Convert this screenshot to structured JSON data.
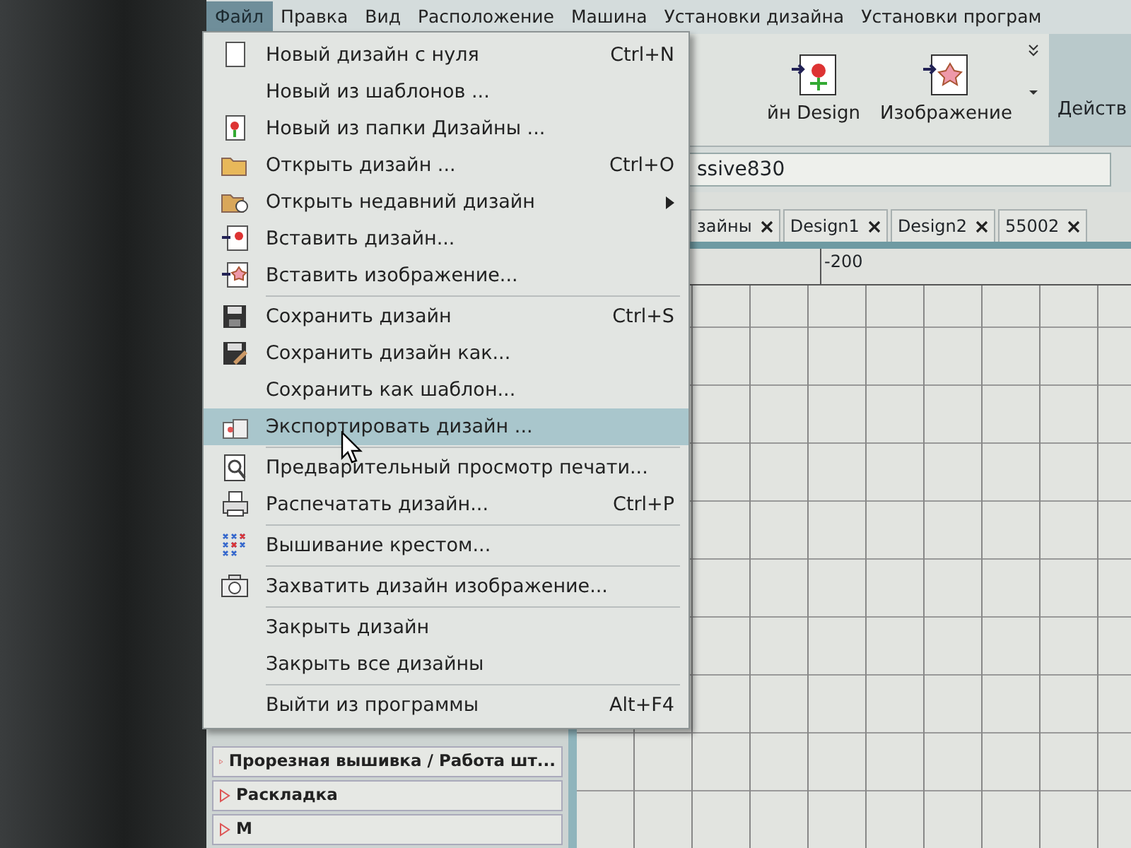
{
  "menu_bar": [
    {
      "label": "Файл",
      "selected": true
    },
    {
      "label": "Правка",
      "selected": false
    },
    {
      "label": "Вид",
      "selected": false
    },
    {
      "label": "Расположение",
      "selected": false
    },
    {
      "label": "Машина",
      "selected": false
    },
    {
      "label": "Установки дизайна",
      "selected": false
    },
    {
      "label": "Установки програм",
      "selected": false
    }
  ],
  "toolbar": {
    "buttons": [
      {
        "label": "йн Design"
      },
      {
        "label": "Изображение"
      }
    ],
    "group_label": "Действ"
  },
  "machine_field": {
    "value": "ssive830"
  },
  "tabs": [
    {
      "label": "зайны",
      "selected": false
    },
    {
      "label": "Design1",
      "selected": false
    },
    {
      "label": "Design2",
      "selected": false
    },
    {
      "label": "55002",
      "selected": false
    }
  ],
  "ruler": {
    "label": "-200"
  },
  "sidebar": {
    "items": [
      {
        "label": "Прорезная вышивка / Работа шт..."
      },
      {
        "label": "Раскладка"
      },
      {
        "label": "М"
      }
    ]
  },
  "file_menu": {
    "items": [
      {
        "kind": "item",
        "label": "Новый дизайн с нуля",
        "shortcut": "Ctrl+N",
        "selected": false,
        "submenu": false
      },
      {
        "kind": "item",
        "label": "Новый из шаблонов ...",
        "selected": false,
        "submenu": false
      },
      {
        "kind": "item",
        "label": "Новый из папки Дизайны ...",
        "selected": false,
        "submenu": false
      },
      {
        "kind": "item",
        "label": "Открыть дизайн ...",
        "shortcut": "Ctrl+O",
        "selected": false,
        "submenu": false
      },
      {
        "kind": "item",
        "label": "Открыть недавний дизайн",
        "selected": false,
        "submenu": true
      },
      {
        "kind": "item",
        "label": "Вставить дизайн...",
        "selected": false,
        "submenu": false
      },
      {
        "kind": "item",
        "label": "Вставить изображение...",
        "selected": false,
        "submenu": false
      },
      {
        "kind": "separator"
      },
      {
        "kind": "item",
        "label": "Сохранить дизайн",
        "shortcut": "Ctrl+S",
        "selected": false,
        "submenu": false
      },
      {
        "kind": "item",
        "label": "Сохранить дизайн  как...",
        "selected": false,
        "submenu": false
      },
      {
        "kind": "item",
        "label": "Сохранить как шаблон...",
        "selected": false,
        "submenu": false
      },
      {
        "kind": "item",
        "label": "Экспортировать дизайн ...",
        "selected": true,
        "submenu": false
      },
      {
        "kind": "separator"
      },
      {
        "kind": "item",
        "label": "Предварительный просмотр печати...",
        "selected": false,
        "submenu": false
      },
      {
        "kind": "item",
        "label": "Распечатать дизайн...",
        "shortcut": "Ctrl+P",
        "selected": false,
        "submenu": false
      },
      {
        "kind": "separator"
      },
      {
        "kind": "item",
        "label": "Вышивание крестом...",
        "selected": false,
        "submenu": false
      },
      {
        "kind": "separator"
      },
      {
        "kind": "item",
        "label": "Захватить дизайн изображение...",
        "selected": false,
        "submenu": false
      },
      {
        "kind": "separator"
      },
      {
        "kind": "item",
        "label": "Закрыть дизайн",
        "selected": false,
        "submenu": false
      },
      {
        "kind": "item",
        "label": "Закрыть все дизайны",
        "selected": false,
        "submenu": false
      },
      {
        "kind": "separator"
      },
      {
        "kind": "item",
        "label": "Выйти из программы",
        "shortcut": "Alt+F4",
        "selected": false,
        "submenu": false
      }
    ]
  }
}
